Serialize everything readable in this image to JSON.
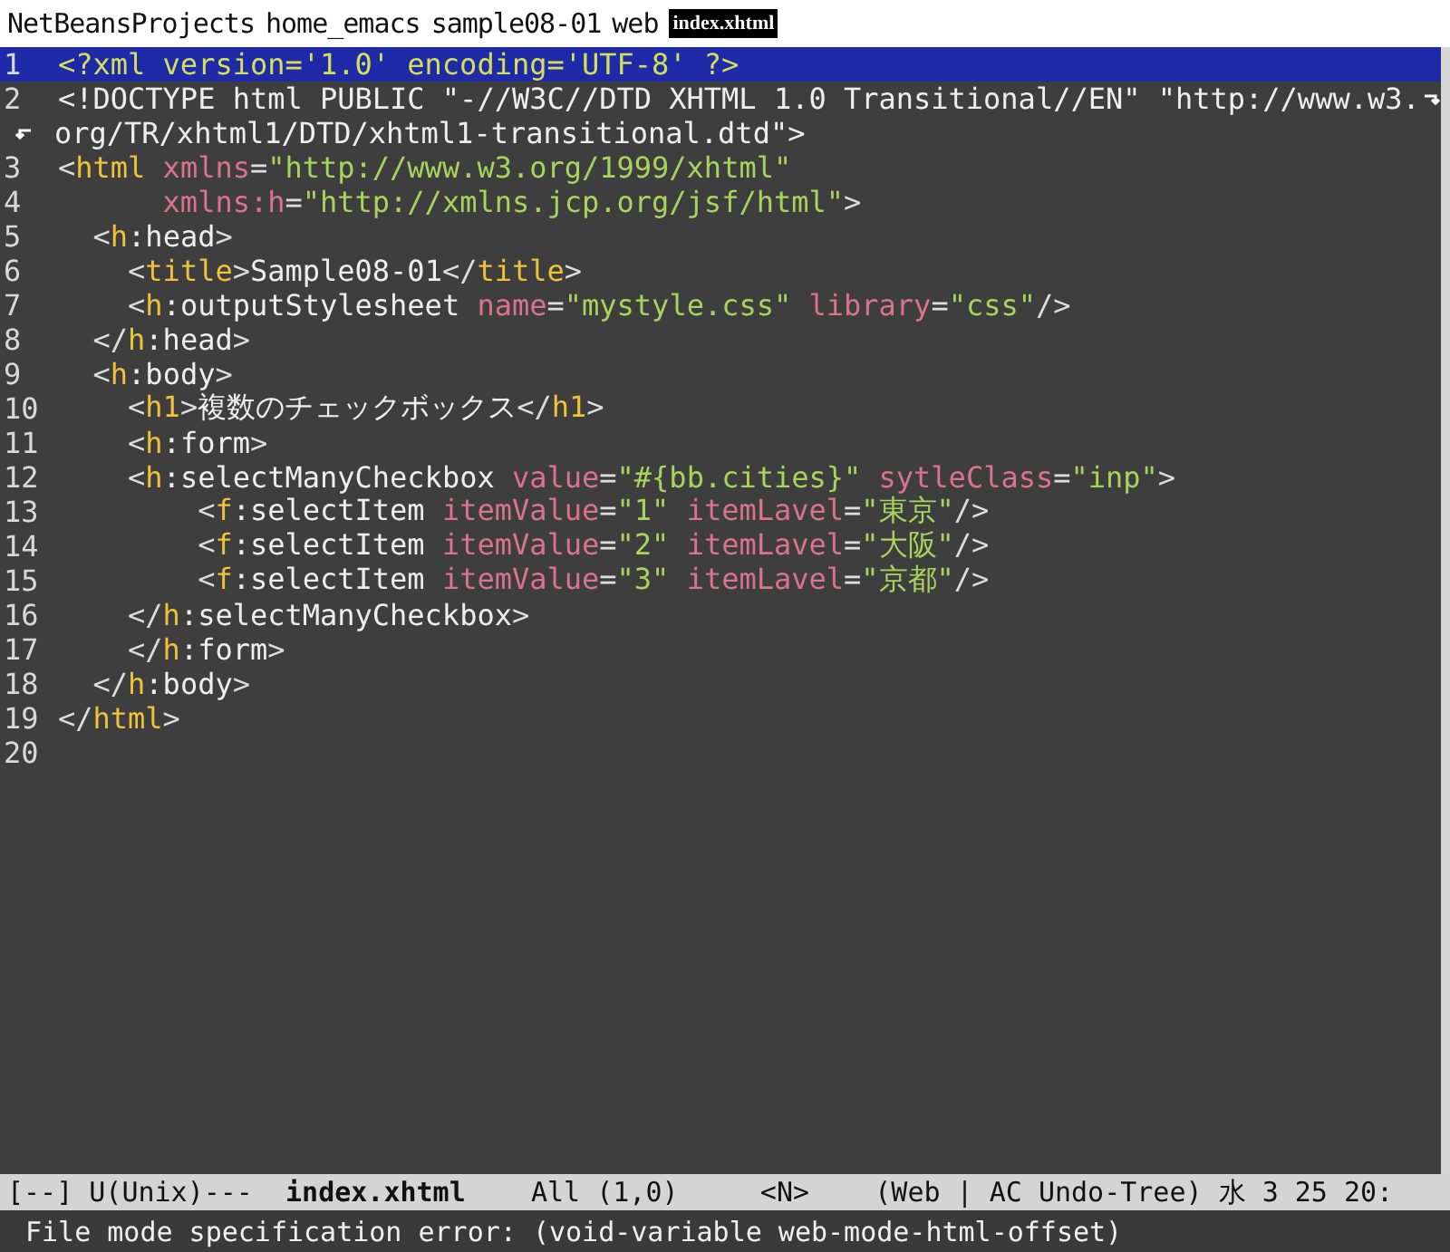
{
  "header": {
    "path": [
      "NetBeansProjects",
      "home_emacs",
      "sample08-01",
      "web"
    ],
    "file": "index.xhtml"
  },
  "buffer": {
    "lines": [
      {
        "number": "1",
        "selected": true,
        "segments": [
          {
            "kind": "decl",
            "text": "<?xml version='1.0' encoding='UTF-8' ?>"
          }
        ]
      },
      {
        "number": "2",
        "selected": false,
        "segments": [
          {
            "kind": "text",
            "text": "<!DOCTYPE html PUBLIC \"-//W3C//DTD XHTML 1.0 Transitional//EN\" \"http://www.w3."
          }
        ],
        "wrap": [
          {
            "kind": "text",
            "text": "org/TR/xhtml1/DTD/xhtml1-transitional.dtd\">"
          }
        ]
      },
      {
        "number": "3",
        "selected": false,
        "segments": [
          {
            "kind": "punct",
            "text": "<"
          },
          {
            "kind": "tag",
            "text": "html"
          },
          {
            "kind": "attr",
            "text": " xmlns"
          },
          {
            "kind": "punct",
            "text": "="
          },
          {
            "kind": "string",
            "text": "\"http://www.w3.org/1999/xhtml\""
          }
        ]
      },
      {
        "number": "4",
        "selected": false,
        "segments": [
          {
            "kind": "attr",
            "text": "      xmlns:h"
          },
          {
            "kind": "punct",
            "text": "="
          },
          {
            "kind": "string",
            "text": "\"http://xmlns.jcp.org/jsf/html\""
          },
          {
            "kind": "punct",
            "text": ">"
          }
        ]
      },
      {
        "number": "5",
        "selected": false,
        "segments": [
          {
            "kind": "punct",
            "text": "  <"
          },
          {
            "kind": "tag",
            "text": "h"
          },
          {
            "kind": "text",
            "text": ":head"
          },
          {
            "kind": "punct",
            "text": ">"
          }
        ]
      },
      {
        "number": "6",
        "selected": false,
        "segments": [
          {
            "kind": "punct",
            "text": "    <"
          },
          {
            "kind": "tag",
            "text": "title"
          },
          {
            "kind": "punct",
            "text": ">"
          },
          {
            "kind": "text",
            "text": "Sample08-01"
          },
          {
            "kind": "punct",
            "text": "</"
          },
          {
            "kind": "tag",
            "text": "title"
          },
          {
            "kind": "punct",
            "text": ">"
          }
        ]
      },
      {
        "number": "7",
        "selected": false,
        "segments": [
          {
            "kind": "punct",
            "text": "    <"
          },
          {
            "kind": "tag",
            "text": "h"
          },
          {
            "kind": "text",
            "text": ":outputStylesheet"
          },
          {
            "kind": "attr",
            "text": " name"
          },
          {
            "kind": "punct",
            "text": "="
          },
          {
            "kind": "string",
            "text": "\"mystyle.css\""
          },
          {
            "kind": "attr",
            "text": " library"
          },
          {
            "kind": "punct",
            "text": "="
          },
          {
            "kind": "string",
            "text": "\"css\""
          },
          {
            "kind": "punct",
            "text": "/>"
          }
        ]
      },
      {
        "number": "8",
        "selected": false,
        "segments": [
          {
            "kind": "punct",
            "text": "  </"
          },
          {
            "kind": "tag",
            "text": "h"
          },
          {
            "kind": "text",
            "text": ":head"
          },
          {
            "kind": "punct",
            "text": ">"
          }
        ]
      },
      {
        "number": "9",
        "selected": false,
        "segments": [
          {
            "kind": "punct",
            "text": "  <"
          },
          {
            "kind": "tag",
            "text": "h"
          },
          {
            "kind": "text",
            "text": ":body"
          },
          {
            "kind": "punct",
            "text": ">"
          }
        ]
      },
      {
        "number": "10",
        "selected": false,
        "segments": [
          {
            "kind": "punct",
            "text": "    <"
          },
          {
            "kind": "tag",
            "text": "h1"
          },
          {
            "kind": "punct",
            "text": ">"
          },
          {
            "kind": "text",
            "text": "複数のチェックボックス"
          },
          {
            "kind": "punct",
            "text": "</"
          },
          {
            "kind": "tag",
            "text": "h1"
          },
          {
            "kind": "punct",
            "text": ">"
          }
        ]
      },
      {
        "number": "11",
        "selected": false,
        "segments": [
          {
            "kind": "punct",
            "text": "    <"
          },
          {
            "kind": "tag",
            "text": "h"
          },
          {
            "kind": "text",
            "text": ":form"
          },
          {
            "kind": "punct",
            "text": ">"
          }
        ]
      },
      {
        "number": "12",
        "selected": false,
        "segments": [
          {
            "kind": "punct",
            "text": "    <"
          },
          {
            "kind": "tag",
            "text": "h"
          },
          {
            "kind": "text",
            "text": ":selectManyCheckbox"
          },
          {
            "kind": "attr",
            "text": " value"
          },
          {
            "kind": "punct",
            "text": "="
          },
          {
            "kind": "string",
            "text": "\"#{bb.cities}\""
          },
          {
            "kind": "attr",
            "text": " sytleClass"
          },
          {
            "kind": "punct",
            "text": "="
          },
          {
            "kind": "string",
            "text": "\"inp\""
          },
          {
            "kind": "punct",
            "text": ">"
          }
        ]
      },
      {
        "number": "13",
        "selected": false,
        "segments": [
          {
            "kind": "punct",
            "text": "        <"
          },
          {
            "kind": "tag",
            "text": "f"
          },
          {
            "kind": "text",
            "text": ":selectItem"
          },
          {
            "kind": "attr",
            "text": " itemValue"
          },
          {
            "kind": "punct",
            "text": "="
          },
          {
            "kind": "string",
            "text": "\"1\""
          },
          {
            "kind": "attr",
            "text": " itemLavel"
          },
          {
            "kind": "punct",
            "text": "="
          },
          {
            "kind": "string",
            "text": "\"東京\""
          },
          {
            "kind": "punct",
            "text": "/>"
          }
        ]
      },
      {
        "number": "14",
        "selected": false,
        "segments": [
          {
            "kind": "punct",
            "text": "        <"
          },
          {
            "kind": "tag",
            "text": "f"
          },
          {
            "kind": "text",
            "text": ":selectItem"
          },
          {
            "kind": "attr",
            "text": " itemValue"
          },
          {
            "kind": "punct",
            "text": "="
          },
          {
            "kind": "string",
            "text": "\"2\""
          },
          {
            "kind": "attr",
            "text": " itemLavel"
          },
          {
            "kind": "punct",
            "text": "="
          },
          {
            "kind": "string",
            "text": "\"大阪\""
          },
          {
            "kind": "punct",
            "text": "/>"
          }
        ]
      },
      {
        "number": "15",
        "selected": false,
        "segments": [
          {
            "kind": "punct",
            "text": "        <"
          },
          {
            "kind": "tag",
            "text": "f"
          },
          {
            "kind": "text",
            "text": ":selectItem"
          },
          {
            "kind": "attr",
            "text": " itemValue"
          },
          {
            "kind": "punct",
            "text": "="
          },
          {
            "kind": "string",
            "text": "\"3\""
          },
          {
            "kind": "attr",
            "text": " itemLavel"
          },
          {
            "kind": "punct",
            "text": "="
          },
          {
            "kind": "string",
            "text": "\"京都\""
          },
          {
            "kind": "punct",
            "text": "/>"
          }
        ]
      },
      {
        "number": "16",
        "selected": false,
        "segments": [
          {
            "kind": "punct",
            "text": "    </"
          },
          {
            "kind": "tag",
            "text": "h"
          },
          {
            "kind": "text",
            "text": ":selectManyCheckbox"
          },
          {
            "kind": "punct",
            "text": ">"
          }
        ]
      },
      {
        "number": "17",
        "selected": false,
        "segments": [
          {
            "kind": "punct",
            "text": "    </"
          },
          {
            "kind": "tag",
            "text": "h"
          },
          {
            "kind": "text",
            "text": ":form"
          },
          {
            "kind": "punct",
            "text": ">"
          }
        ]
      },
      {
        "number": "18",
        "selected": false,
        "segments": [
          {
            "kind": "punct",
            "text": "  </"
          },
          {
            "kind": "tag",
            "text": "h"
          },
          {
            "kind": "text",
            "text": ":body"
          },
          {
            "kind": "punct",
            "text": ">"
          }
        ]
      },
      {
        "number": "19",
        "selected": false,
        "segments": [
          {
            "kind": "punct",
            "text": "</"
          },
          {
            "kind": "tag",
            "text": "html"
          },
          {
            "kind": "punct",
            "text": ">"
          }
        ]
      },
      {
        "number": "20",
        "selected": false
      }
    ]
  },
  "mode_line": [
    {
      "kind": "plain",
      "text": "[--] U(Unix)---  "
    },
    {
      "kind": "bold",
      "text": "index.xhtml"
    },
    {
      "kind": "plain",
      "text": "    All (1,0)     <N>    (Web | AC Undo-Tree) 水 3 25 20:"
    }
  ],
  "minibuffer": {
    "message": "File mode specification error: (void-variable web-mode-html-offset)"
  }
}
